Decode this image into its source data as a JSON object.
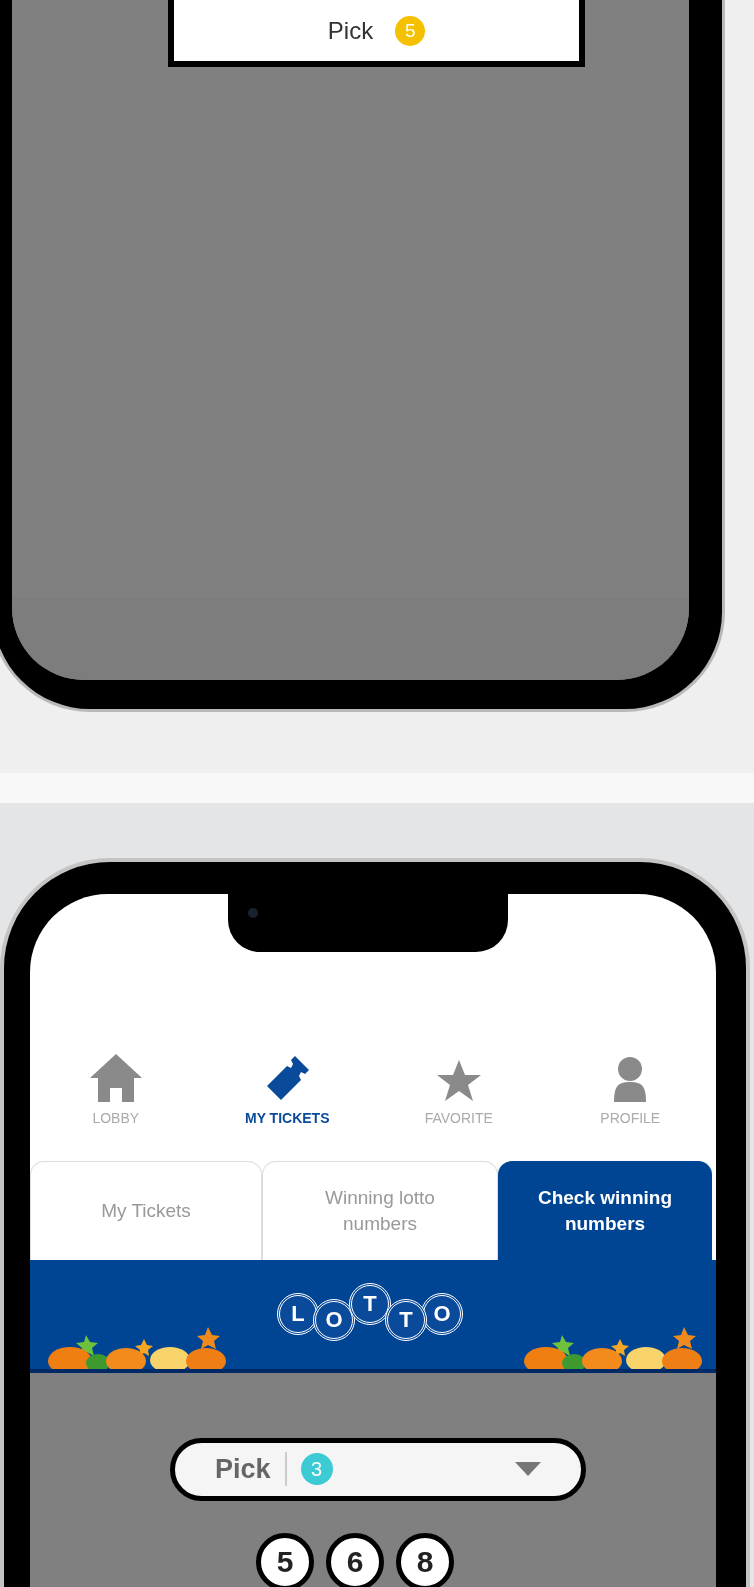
{
  "top_phone": {
    "pick_label": "Pick",
    "pick_badge": "5"
  },
  "nav": [
    {
      "label": "LOBBY",
      "kind": "house",
      "selected": false
    },
    {
      "label": "MY TICKETS",
      "kind": "ticket",
      "selected": true
    },
    {
      "label": "FAVORITE",
      "kind": "star",
      "selected": false
    },
    {
      "label": "PROFILE",
      "kind": "person",
      "selected": false
    }
  ],
  "tabs": [
    {
      "label": "My Tickets",
      "selected": false
    },
    {
      "label": "Winning lotto numbers",
      "selected": false
    },
    {
      "label": "Check winning numbers",
      "selected": true
    }
  ],
  "banner": {
    "logo_letters": [
      "L",
      "O",
      "T",
      "T",
      "O"
    ]
  },
  "pick_dropdown": {
    "label": "Pick",
    "badge": "3"
  },
  "numbers": [
    "5",
    "6",
    "8"
  ]
}
